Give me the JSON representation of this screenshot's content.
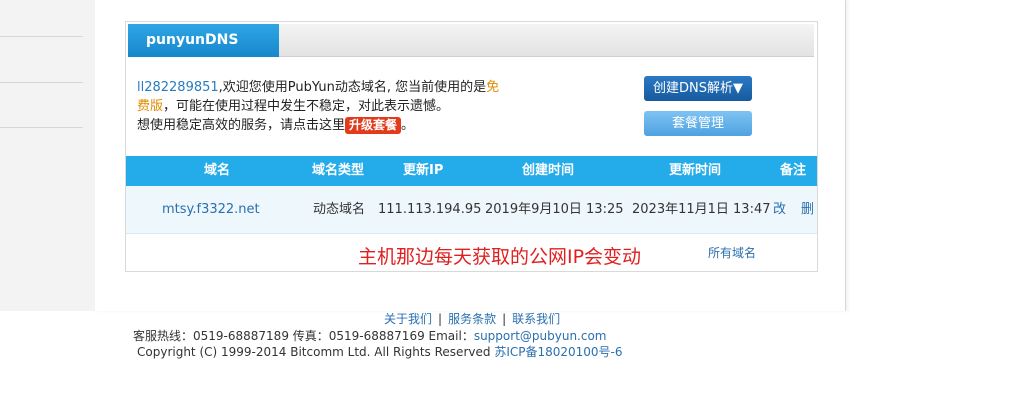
{
  "panel": {
    "title": "punyunDNS"
  },
  "welcome": {
    "user": "ll282289851",
    "line1_pre": ",欢迎您使用PubYun动态域名, 您当前使用的是",
    "free1": "免",
    "free2": "费版",
    "line2_rest": "，可能在使用过程中发生不稳定，对此表示遗憾。",
    "line3": "想使用稳定高效的服务，请点击这里",
    "upgrade_label": "升级套餐",
    "line3_end": "。"
  },
  "actions": {
    "create_dns": "创建DNS解析▼",
    "manage_plan": "套餐管理"
  },
  "table": {
    "headers": [
      "域名",
      "域名类型",
      "更新IP",
      "创建时间",
      "更新时间",
      "备注"
    ],
    "rows": [
      {
        "domain": "mtsy.f3322.net",
        "type": "动态域名",
        "ip": "111.113.194.95",
        "created": "2019年9月10日 13:25",
        "updated": "2023年11月1日 13:47",
        "edit": "改",
        "delete": "删"
      }
    ]
  },
  "annotation": "主机那边每天获取的公网IP会变动",
  "all_domains": "所有域名",
  "footer": {
    "links": [
      "关于我们",
      "服务条款",
      "联系我们"
    ],
    "separator": "|",
    "service_line": "客服热线：0519-68887189   传真：0519-68887169   Email：",
    "email": "support@pubyun.com",
    "copyright": "Copyright (C) 1999-2014 Bitcomm Ltd. All Rights Reserved",
    "icp": "苏ICP备18020100号-6"
  }
}
